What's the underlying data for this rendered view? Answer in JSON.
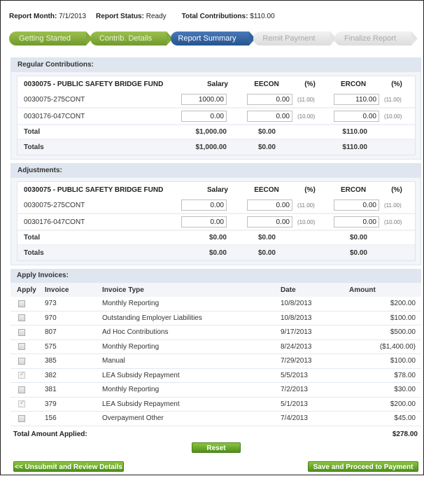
{
  "header": {
    "report_month_label": "Report Month:",
    "report_month_value": "7/1/2013",
    "report_status_label": "Report Status:",
    "report_status_value": "Ready",
    "total_contrib_label": "Total Contributions:",
    "total_contrib_value": "$110.00"
  },
  "steps": [
    {
      "label": "Getting Started",
      "state": "done"
    },
    {
      "label": "Contrib. Details",
      "state": "done"
    },
    {
      "label": "Report Summary",
      "state": "active"
    },
    {
      "label": "Remit Payment",
      "state": "todo"
    },
    {
      "label": "Finalize Report",
      "state": "todo"
    }
  ],
  "columns": {
    "salary": "Salary",
    "eecon": "EECON",
    "pct": "(%)",
    "ercon": "ERCON"
  },
  "regular": {
    "title": "Regular Contributions:",
    "fund": "0030075 - PUBLIC SAFETY BRIDGE FUND",
    "rows": [
      {
        "code": "0030075-275CONT",
        "salary": "1000.00",
        "eecon": "0.00",
        "ee_pct": "(11.00)",
        "ercon": "110.00",
        "er_pct": "(11.00)"
      },
      {
        "code": "0030176-047CONT",
        "salary": "0.00",
        "eecon": "0.00",
        "ee_pct": "(10.00)",
        "ercon": "0.00",
        "er_pct": "(10.00)"
      }
    ],
    "total": {
      "label": "Total",
      "salary": "$1,000.00",
      "eecon": "$0.00",
      "ercon": "$110.00"
    },
    "totals": {
      "label": "Totals",
      "salary": "$1,000.00",
      "eecon": "$0.00",
      "ercon": "$110.00"
    }
  },
  "adjustments": {
    "title": "Adjustments:",
    "fund": "0030075 - PUBLIC SAFETY BRIDGE FUND",
    "rows": [
      {
        "code": "0030075-275CONT",
        "salary": "0.00",
        "eecon": "0.00",
        "ee_pct": "(11.00)",
        "ercon": "0.00",
        "er_pct": "(11.00)"
      },
      {
        "code": "0030176-047CONT",
        "salary": "0.00",
        "eecon": "0.00",
        "ee_pct": "(10.00)",
        "ercon": "0.00",
        "er_pct": "(10.00)"
      }
    ],
    "total": {
      "label": "Total",
      "salary": "$0.00",
      "eecon": "$0.00",
      "ercon": "$0.00"
    },
    "totals": {
      "label": "Totals",
      "salary": "$0.00",
      "eecon": "$0.00",
      "ercon": "$0.00"
    }
  },
  "invoices": {
    "title": "Apply Invoices:",
    "headers": {
      "apply": "Apply",
      "invoice": "Invoice",
      "type": "Invoice Type",
      "date": "Date",
      "amount": "Amount"
    },
    "rows": [
      {
        "checked": false,
        "invoice": "973",
        "type": "Monthly Reporting",
        "date": "10/8/2013",
        "amount": "$200.00"
      },
      {
        "checked": false,
        "invoice": "970",
        "type": "Outstanding Employer Liabilities",
        "date": "10/8/2013",
        "amount": "$100.00"
      },
      {
        "checked": false,
        "invoice": "807",
        "type": "Ad Hoc Contributions",
        "date": "9/17/2013",
        "amount": "$500.00"
      },
      {
        "checked": false,
        "invoice": "575",
        "type": "Monthly Reporting",
        "date": "8/24/2013",
        "amount": "($1,400.00)"
      },
      {
        "checked": false,
        "invoice": "385",
        "type": "Manual",
        "date": "7/29/2013",
        "amount": "$100.00"
      },
      {
        "checked": true,
        "invoice": "382",
        "type": "LEA Subsidy Repayment",
        "date": "5/5/2013",
        "amount": "$78.00"
      },
      {
        "checked": false,
        "invoice": "381",
        "type": "Monthly Reporting",
        "date": "7/2/2013",
        "amount": "$30.00"
      },
      {
        "checked": true,
        "invoice": "379",
        "type": "LEA Subsidy Repayment",
        "date": "5/1/2013",
        "amount": "$200.00"
      },
      {
        "checked": false,
        "invoice": "156",
        "type": "Overpayment Other",
        "date": "7/4/2013",
        "amount": "$45.00"
      }
    ],
    "total_applied_label": "Total Amount Applied:",
    "total_applied_value": "$278.00"
  },
  "buttons": {
    "reset": "Reset",
    "unsubmit": "<< Unsubmit and Review Details",
    "proceed": "Save and Proceed to Payment >>"
  }
}
